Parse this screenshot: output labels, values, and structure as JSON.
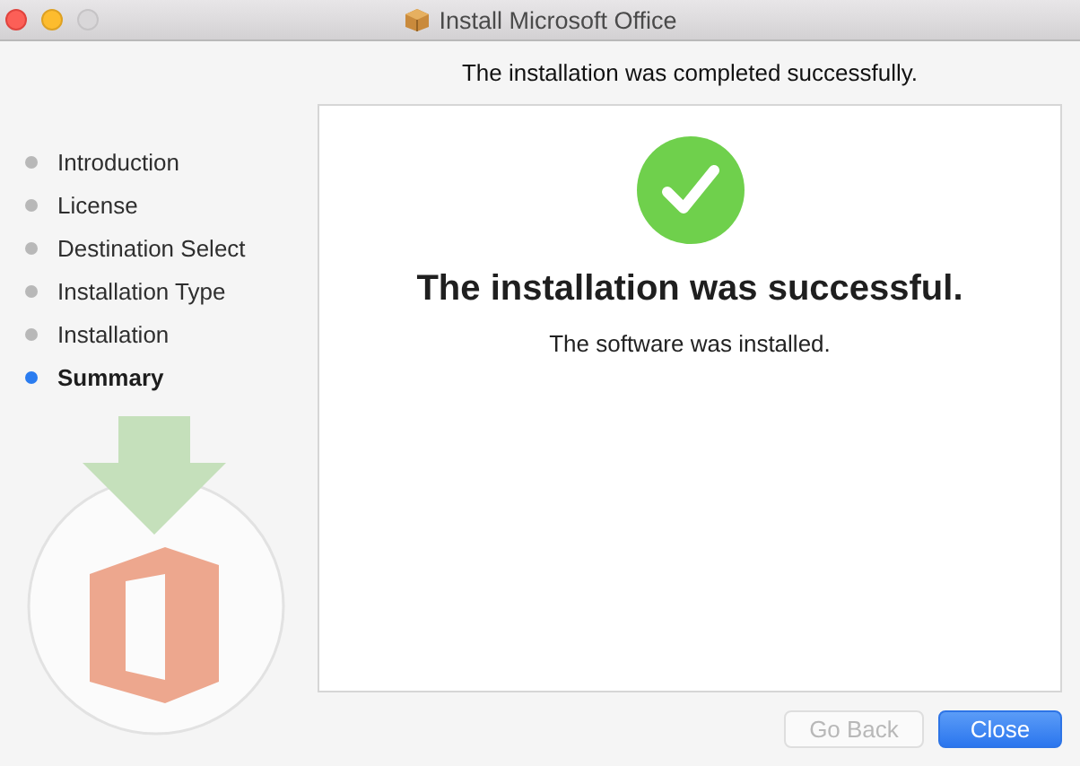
{
  "window": {
    "title": "Install Microsoft Office"
  },
  "heading": "The installation was completed successfully.",
  "steps": [
    {
      "label": "Introduction",
      "selected": false
    },
    {
      "label": "License",
      "selected": false
    },
    {
      "label": "Destination Select",
      "selected": false
    },
    {
      "label": "Installation Type",
      "selected": false
    },
    {
      "label": "Installation",
      "selected": false
    },
    {
      "label": "Summary",
      "selected": true
    }
  ],
  "result": {
    "title": "The installation was successful.",
    "message": "The software was installed."
  },
  "buttons": [
    {
      "label": "Go Back",
      "disabled": true,
      "default": false
    },
    {
      "label": "Close",
      "disabled": false,
      "default": true
    }
  ]
}
